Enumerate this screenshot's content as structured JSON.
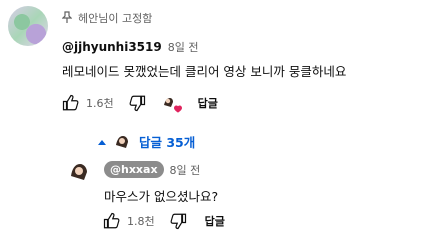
{
  "pinned_label": "헤안님이 고정함",
  "comment": {
    "author": "@jjhyunhi3519",
    "time": "8일 전",
    "text": "레모네이드 못깼었는데 클리어 영상 보니까 뭉클하네요",
    "likes": "1.6천",
    "reply_label": "답글"
  },
  "replies_toggle": "답글 35개",
  "reply": {
    "author": "@hxxax",
    "time": "8일 전",
    "text": "마우스가 없으셨나요?",
    "likes": "1.8천",
    "reply_label": "답글"
  },
  "icons": [
    "pin-icon",
    "thumb-up-icon",
    "thumb-down-icon",
    "heart-icon",
    "caret-up-icon",
    "avatar"
  ],
  "colors": {
    "link": "#065fd4",
    "heart": "#e0245e",
    "muted": "#606060",
    "chip": "#8c8c8c"
  }
}
